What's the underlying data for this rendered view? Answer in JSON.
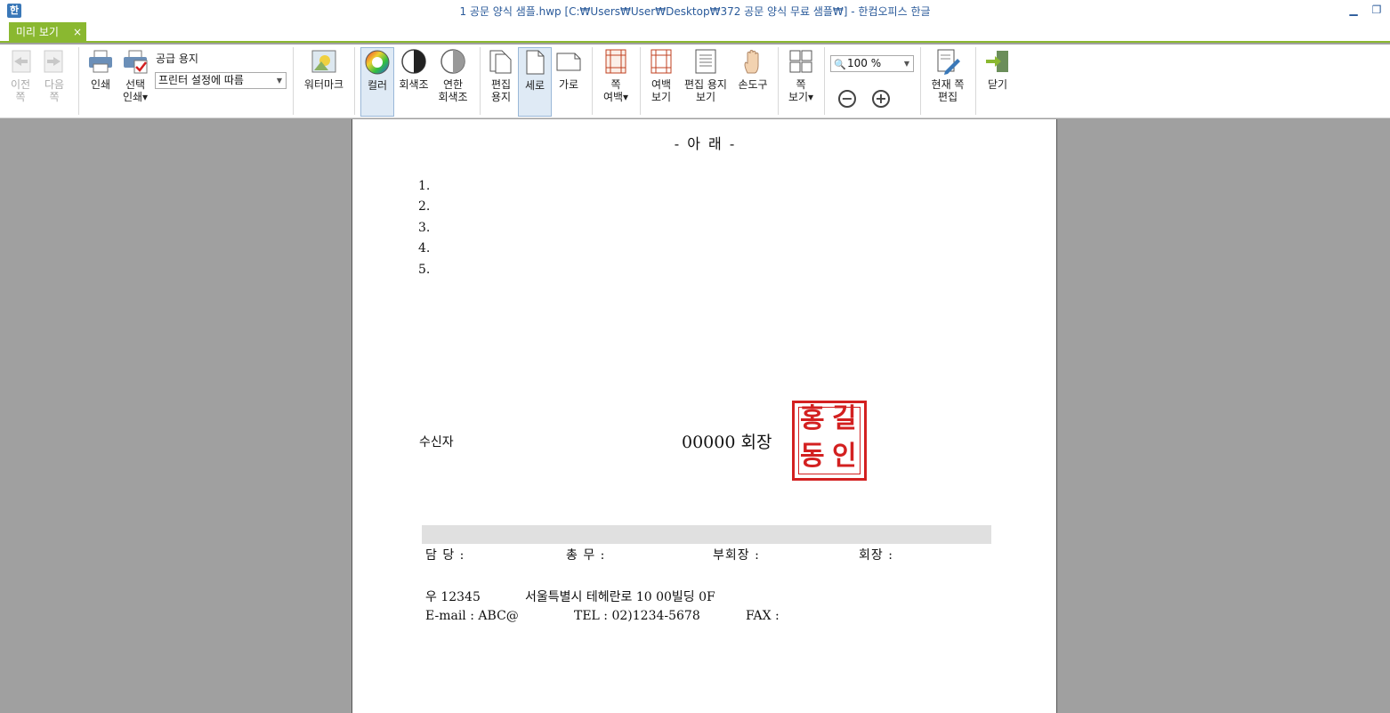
{
  "window": {
    "title": "1 공문 양식 샘플.hwp [C:₩Users₩User₩Desktop₩372 공문 양식 무료 샘플₩] - 한컴오피스 한글",
    "minimize_icon": "minimize-icon",
    "restore_icon": "restore-icon"
  },
  "tab": {
    "label": "미리 보기",
    "close": "×"
  },
  "toolbar": {
    "prev_page": "이전\n쪽",
    "next_page": "다음\n쪽",
    "print": "인쇄",
    "select_print": "선택\n인쇄▾",
    "paper_label": "공급 용지",
    "paper_value": "프린터 설정에 따름",
    "watermark": "워터마크",
    "color": "컬러",
    "grayscale": "회색조",
    "light_grayscale": "연한\n회색조",
    "edit_paper": "편집\n용지",
    "portrait": "세로",
    "landscape": "가로",
    "page_margin": "쪽\n여백▾",
    "margin_view": "여백\n보기",
    "edit_paper_view": "편집 용지\n보기",
    "hand_tool": "손도구",
    "page_view": "쪽\n보기▾",
    "zoom_value": "100 %",
    "zoom_out": "−",
    "zoom_in": "+",
    "edit_current_page": "현재 쪽\n편집",
    "close": "닫기"
  },
  "document": {
    "heading": "- 아      래 -",
    "items": [
      "1.",
      "2.",
      "3.",
      "4.",
      "5."
    ],
    "recipient_label": "수신자",
    "chairman": "00000  회장",
    "seal_chars": [
      "홍",
      "길",
      "동",
      "인"
    ],
    "signatures": [
      "담  당 :",
      "총  무 :",
      "부회장 :",
      "회장 :"
    ],
    "address_line": [
      "우  12345",
      "서울특별시  테헤란로  10  00빌딩  0F"
    ],
    "contact_line": [
      "E-mail  :  ABC@",
      "TEL  :  02)1234-5678",
      "FAX  :"
    ]
  },
  "colors": {
    "accent": "#8ab830",
    "seal": "#d32020",
    "title": "#2a5a9a"
  }
}
